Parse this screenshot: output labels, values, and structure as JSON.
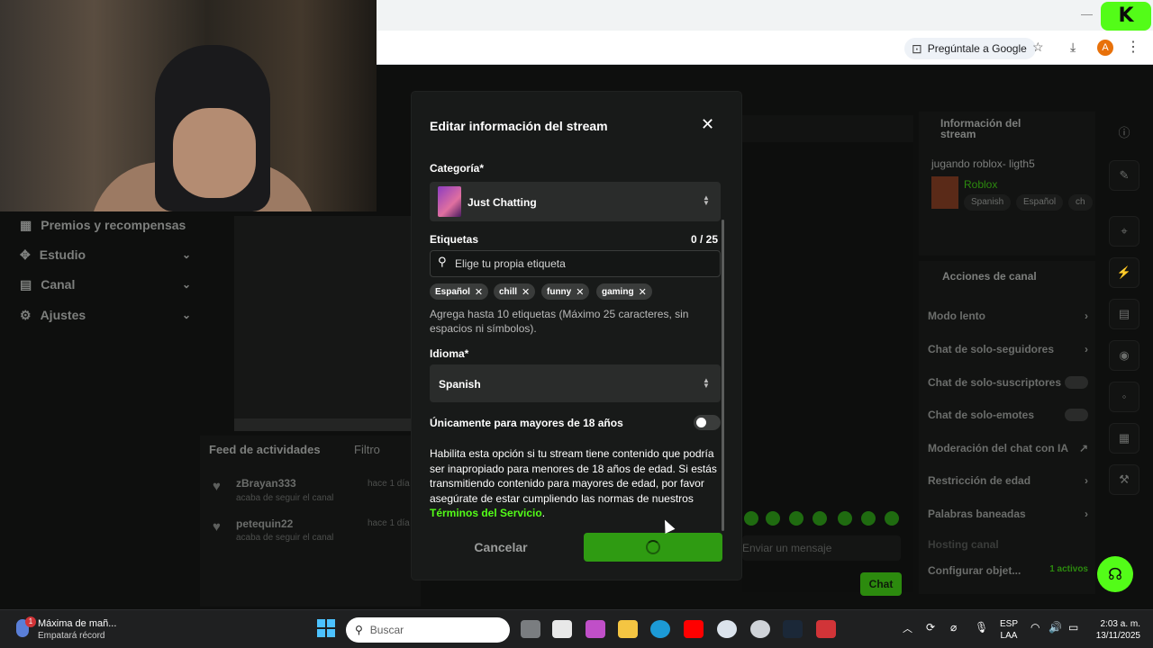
{
  "browser": {
    "ask_google": "Pregúntale a Google",
    "profile_initial": "A",
    "kick_logo": "K"
  },
  "sidebar": {
    "items": [
      {
        "label": "Premios y recompensas",
        "icon": "gift-icon"
      },
      {
        "label": "Estudio",
        "icon": "studio-icon"
      },
      {
        "label": "Canal",
        "icon": "channel-icon"
      },
      {
        "label": "Ajustes",
        "icon": "gear-icon"
      }
    ]
  },
  "feed": {
    "title": "Feed de actividades",
    "filter": "Filtro",
    "items": [
      {
        "user": "zBrayan333",
        "action": "acaba de seguir el canal",
        "time": "hace 1 día"
      },
      {
        "user": "petequin22",
        "action": "acaba de seguir el canal",
        "time": "hace 1 día"
      }
    ]
  },
  "chat": {
    "input_placeholder": "Enviar un mensaje",
    "send_label": "Chat"
  },
  "info_panel": {
    "title": "Información del stream",
    "stream_title": "jugando roblox- ligth5",
    "category": "Roblox",
    "tags": [
      "Spanish",
      "Español",
      "ch"
    ]
  },
  "actions_panel": {
    "title": "Acciones de canal",
    "items": [
      {
        "label": "Modo lento",
        "control": "chevron"
      },
      {
        "label": "Chat de solo-seguidores",
        "control": "chevron"
      },
      {
        "label": "Chat de solo-suscriptores",
        "control": "toggle"
      },
      {
        "label": "Chat de solo-emotes",
        "control": "toggle"
      },
      {
        "label": "Moderación del chat con IA",
        "control": "external"
      },
      {
        "label": "Restricción de edad",
        "control": "chevron"
      },
      {
        "label": "Palabras baneadas",
        "control": "chevron"
      },
      {
        "label": "Hosting canal",
        "control": "none"
      },
      {
        "label": "Configurar objet...",
        "control": "status",
        "status": "1 activos"
      }
    ]
  },
  "dialog": {
    "title": "Editar información del stream",
    "category_label": "Categoría*",
    "category_value": "Just Chatting",
    "tags_label": "Etiquetas",
    "tags_count": "0 / 25",
    "tags_placeholder": "Elige tu propia etiqueta",
    "tags": [
      "Español",
      "chill",
      "funny",
      "gaming"
    ],
    "tags_help": "Agrega hasta 10 etiquetas (Máximo 25 caracteres, sin espacios ni símbolos).",
    "language_label": "Idioma*",
    "language_value": "Spanish",
    "adult_label": "Únicamente para mayores de 18 años",
    "adult_enabled": false,
    "adult_description": "Habilita esta opción si tu stream tiene contenido que podría ser inapropiado para menores de 18 años de edad. Si estás transmitiendo contenido para mayores de edad, por favor asegúrate de estar cumpliendo las normas de nuestros",
    "terms_link": "Términos del Servicio",
    "terms_suffix": ".",
    "cancel_label": "Cancelar",
    "save_state": "loading"
  },
  "taskbar": {
    "notification_title": "Máxima de mañ...",
    "notification_sub": "Empatará récord",
    "notification_badge": "1",
    "search_placeholder": "Buscar",
    "lang_top": "ESP",
    "lang_bottom": "LAA",
    "time": "2:03 a. m.",
    "date": "13/11/2025"
  },
  "colors": {
    "accent": "#53fc18",
    "dialog_bg": "#181a19",
    "field_bg": "#2a2c2b"
  }
}
